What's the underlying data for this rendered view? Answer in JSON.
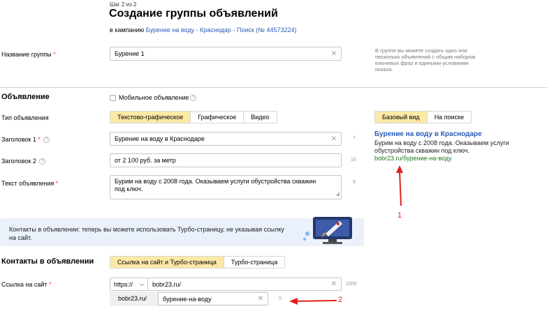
{
  "header": {
    "step": "Шаг 2 из 2",
    "title": "Создание группы объявлений",
    "campaign_prefix": "в кампанию",
    "campaign_link": "Бурение на воду - Краснодар - Поиск (№ 44573224)"
  },
  "group": {
    "label": "Название группы",
    "required": "*",
    "value": "Бурение 1",
    "help": "В группе вы можете создать одно или несколько объявлений с общим набором ключевых фраз и едиными условиями показа."
  },
  "ad": {
    "section_title": "Объявление",
    "mobile_label": "Мобильное объявление",
    "type_label": "Тип объявления",
    "types": [
      "Текстово-графическое",
      "Графическое",
      "Видео"
    ],
    "title1_label": "Заголовок 1",
    "title1_value": "Бурение на воду в Краснодаре",
    "title1_counter": "7",
    "title2_label": "Заголовок 2",
    "title2_value": "от 2 100 руб. за метр",
    "title2_counter": "10",
    "text_label": "Текст объявления",
    "text_value": "Бурим на воду с 2008 года. Оказываем услуги обустройства скважин под ключ.",
    "text_counter": "9"
  },
  "preview": {
    "tabs": [
      "Базовый вид",
      "На поиске"
    ],
    "title": "Бурение на воду в Краснодаре",
    "text": "Бурим на воду с 2008 года. Оказываем услуги обустройства скважин под ключ.",
    "url": "bobr23.ru/бурение-на-воду"
  },
  "annotations": {
    "arrow1": "1",
    "arrow2": "2"
  },
  "banner": {
    "text": "Контакты в объявлении: теперь вы можете использовать Турбо-страницу, не указывая ссылку на сайт."
  },
  "contacts": {
    "section_title": "Контакты в объявлении",
    "options": [
      "Ссылка на сайт и Турбо-страница",
      "Турбо-страница"
    ],
    "site_label": "Ссылка на сайт",
    "protocol": "https://",
    "site_value": "bobr23.ru/",
    "site_counter": "1006",
    "display_domain": "bobr23.ru/",
    "display_path": "бурение-на-воду",
    "display_counter": "5"
  },
  "colors": {
    "accent": "#fde9a6",
    "link": "#2b5cb8",
    "url_green": "#1f7a1f",
    "arrow": "#e0201a",
    "banner_bg": "#eaf1fb"
  }
}
